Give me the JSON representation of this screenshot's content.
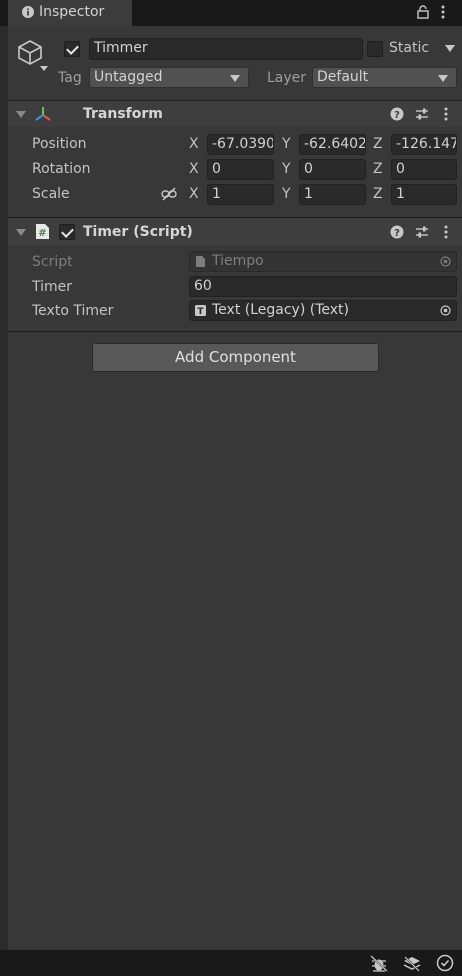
{
  "tab": {
    "title": "Inspector"
  },
  "object": {
    "name": "Timmer",
    "active": true,
    "static_label": "Static",
    "tag_label": "Tag",
    "tag_value": "Untagged",
    "layer_label": "Layer",
    "layer_value": "Default"
  },
  "transform": {
    "title": "Transform",
    "rows": [
      {
        "label": "Position",
        "x": "-67.0390",
        "y": "-62.6402",
        "z": "-126.1474"
      },
      {
        "label": "Rotation",
        "x": "0",
        "y": "0",
        "z": "0"
      },
      {
        "label": "Scale",
        "x": "1",
        "y": "1",
        "z": "1"
      }
    ],
    "axes": {
      "x": "X",
      "y": "Y",
      "z": "Z"
    }
  },
  "timer_script": {
    "title": "Timer (Script)",
    "enabled": true,
    "script_label": "Script",
    "script_value": "Tiempo",
    "timer_label": "Timer",
    "timer_value": "60",
    "texto_label": "Texto Timer",
    "texto_value": "Text (Legacy) (Text)"
  },
  "add_component_label": "Add Component",
  "icons": {
    "info": "info-icon",
    "lock": "lock-icon",
    "kebab": "kebab-menu-icon",
    "cube": "gameobject-cube-icon",
    "transform": "transform-axes-icon",
    "script": "csharp-script-icon",
    "help": "help-icon",
    "preset": "presets-icon",
    "link": "constrain-proportions-icon",
    "target": "object-picker-icon",
    "bug": "debug-icon",
    "layers": "layers-icon",
    "status": "status-check-icon"
  }
}
